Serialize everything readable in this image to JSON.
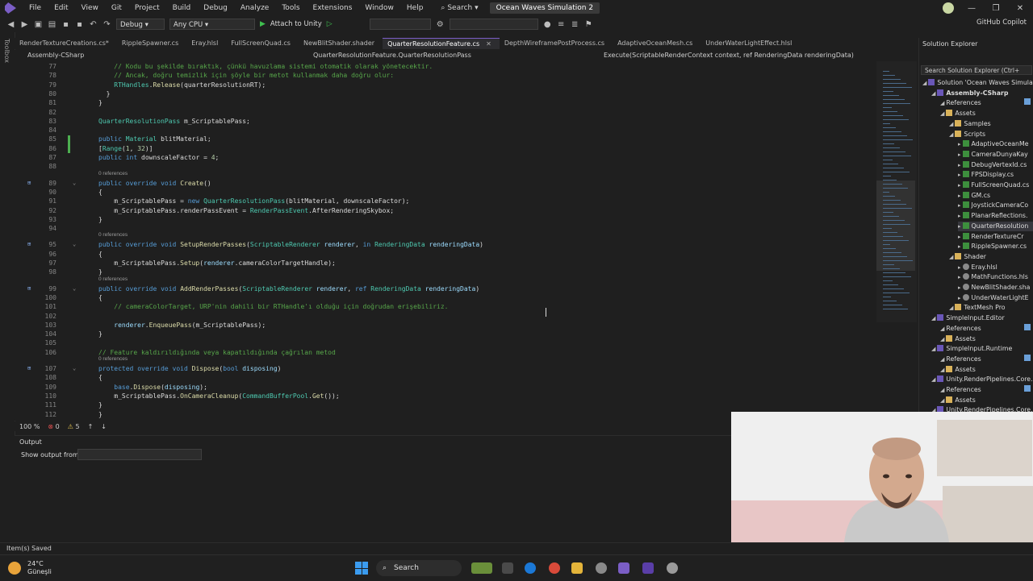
{
  "menubar": {
    "items": [
      "File",
      "Edit",
      "View",
      "Git",
      "Project",
      "Build",
      "Debug",
      "Analyze",
      "Tools",
      "Extensions",
      "Window",
      "Help"
    ],
    "search": "Search",
    "solution_name": "Ocean Waves Simulation 2",
    "copilot": "GitHub Copilot"
  },
  "toolbar": {
    "configuration": "Debug",
    "platform": "Any CPU",
    "attach": "Attach to Unity"
  },
  "left_strip": {
    "label": "Toolbox"
  },
  "tabs": [
    {
      "label": "RenderTextureCreations.cs*"
    },
    {
      "label": "RippleSpawner.cs"
    },
    {
      "label": "Eray.hlsl"
    },
    {
      "label": "FullScreenQuad.cs"
    },
    {
      "label": "NewBlitShader.shader"
    },
    {
      "label": "QuarterResolutionFeature.cs",
      "active": true
    },
    {
      "label": "DepthWireframePostProcess.cs"
    },
    {
      "label": "AdaptiveOceanMesh.cs"
    },
    {
      "label": "UnderWaterLightEffect.hlsl"
    }
  ],
  "navbar": {
    "project": "Assembly-CSharp",
    "type": "QuarterResolutionFeature.QuarterResolutionPass",
    "member": "Execute(ScriptableRenderContext context, ref RenderingData renderingData)"
  },
  "code": {
    "refs": "0 references",
    "lines": [
      {
        "n": "77",
        "t": "    // Kodu bu şekilde bıraktık, çünkü havuzlama sistemi otomatik olarak yönetecektir."
      },
      {
        "n": "78",
        "t": "    // Ancak, doğru temizlik için şöyle bir metot kullanmak daha doğru olur:"
      },
      {
        "n": "79",
        "t": "    RTHandles.Release(quarterResolutionRT);"
      },
      {
        "n": "80",
        "t": "  }"
      },
      {
        "n": "81",
        "t": "}"
      },
      {
        "n": "82",
        "t": ""
      },
      {
        "n": "83",
        "t": "QuarterResolutionPass m_ScriptablePass;"
      },
      {
        "n": "84",
        "t": ""
      },
      {
        "n": "85",
        "t": "public Material blitMaterial;"
      },
      {
        "n": "86",
        "t": "[Range(1, 32)]"
      },
      {
        "n": "87",
        "t": "public int downscaleFactor = 4;"
      },
      {
        "n": "88",
        "t": ""
      },
      {
        "n": "89",
        "t": "public override void Create()"
      },
      {
        "n": "90",
        "t": "{"
      },
      {
        "n": "91",
        "t": "    m_ScriptablePass = new QuarterResolutionPass(blitMaterial, downscaleFactor);"
      },
      {
        "n": "92",
        "t": "    m_ScriptablePass.renderPassEvent = RenderPassEvent.AfterRenderingSkybox;"
      },
      {
        "n": "93",
        "t": "}"
      },
      {
        "n": "94",
        "t": ""
      },
      {
        "n": "95",
        "t": "public override void SetupRenderPasses(ScriptableRenderer renderer, in RenderingData renderingData)"
      },
      {
        "n": "96",
        "t": "{"
      },
      {
        "n": "97",
        "t": "    m_ScriptablePass.Setup(renderer.cameraColorTargetHandle);"
      },
      {
        "n": "98",
        "t": "}"
      },
      {
        "n": "99",
        "t": "public override void AddRenderPasses(ScriptableRenderer renderer, ref RenderingData renderingData)"
      },
      {
        "n": "100",
        "t": "{"
      },
      {
        "n": "101",
        "t": "    // cameraColorTarget, URP'nin dahili bir RTHandle'ı olduğu için doğrudan erişebiliriz."
      },
      {
        "n": "102",
        "t": ""
      },
      {
        "n": "103",
        "t": "    renderer.EnqueuePass(m_ScriptablePass);"
      },
      {
        "n": "104",
        "t": "}"
      },
      {
        "n": "105",
        "t": ""
      },
      {
        "n": "106",
        "t": "// Feature kaldırıldığında veya kapatıldığında çağrılan metod"
      },
      {
        "n": "107",
        "t": "protected override void Dispose(bool disposing)"
      },
      {
        "n": "108",
        "t": "{"
      },
      {
        "n": "109",
        "t": "    base.Dispose(disposing);"
      },
      {
        "n": "110",
        "t": "    m_ScriptablePass.OnCameraCleanup(CommandBufferPool.Get());"
      },
      {
        "n": "111",
        "t": "}"
      },
      {
        "n": "112",
        "t": "}"
      }
    ]
  },
  "editor_status": {
    "zoom": "100 %",
    "errors": "0",
    "warnings": "5"
  },
  "output": {
    "title": "Output",
    "show_from": "Show output from:"
  },
  "solution_explorer": {
    "title": "Solution Explorer",
    "search": "Search Solution Explorer (Ctrl+",
    "nodes": [
      {
        "label": "Solution 'Ocean Waves Simulati",
        "indent": 0,
        "icon": "proj"
      },
      {
        "label": "Assembly-CSharp",
        "indent": 1,
        "icon": "proj",
        "bold": true
      },
      {
        "label": "References",
        "indent": 2,
        "icon": "ref"
      },
      {
        "label": "Assets",
        "indent": 2,
        "icon": "folder"
      },
      {
        "label": "Samples",
        "indent": 3,
        "icon": "folder"
      },
      {
        "label": "Scripts",
        "indent": 3,
        "icon": "folder"
      },
      {
        "label": "AdaptiveOceanMe",
        "indent": 4,
        "icon": "cs"
      },
      {
        "label": "CameraDunyaKay",
        "indent": 4,
        "icon": "cs"
      },
      {
        "label": "DebugVertexId.cs",
        "indent": 4,
        "icon": "cs"
      },
      {
        "label": "FPSDisplay.cs",
        "indent": 4,
        "icon": "cs"
      },
      {
        "label": "FullScreenQuad.cs",
        "indent": 4,
        "icon": "cs"
      },
      {
        "label": "GM.cs",
        "indent": 4,
        "icon": "cs"
      },
      {
        "label": "JoystickCameraCo",
        "indent": 4,
        "icon": "cs"
      },
      {
        "label": "PlanarReflections.",
        "indent": 4,
        "icon": "cs"
      },
      {
        "label": "QuarterResolution",
        "indent": 4,
        "icon": "cs",
        "selected": true
      },
      {
        "label": "RenderTextureCr",
        "indent": 4,
        "icon": "cs"
      },
      {
        "label": "RippleSpawner.cs",
        "indent": 4,
        "icon": "cs"
      },
      {
        "label": "Shader",
        "indent": 3,
        "icon": "folder"
      },
      {
        "label": "Eray.hlsl",
        "indent": 4,
        "icon": "hlsl"
      },
      {
        "label": "MathFunctions.hls",
        "indent": 4,
        "icon": "hlsl"
      },
      {
        "label": "NewBlitShader.sha",
        "indent": 4,
        "icon": "hlsl"
      },
      {
        "label": "UnderWaterLightE",
        "indent": 4,
        "icon": "hlsl"
      },
      {
        "label": "TextMesh Pro",
        "indent": 3,
        "icon": "folder"
      },
      {
        "label": "SimpleInput.Editor",
        "indent": 1,
        "icon": "proj"
      },
      {
        "label": "References",
        "indent": 2,
        "icon": "ref"
      },
      {
        "label": "Assets",
        "indent": 2,
        "icon": "folder"
      },
      {
        "label": "SimpleInput.Runtime",
        "indent": 1,
        "icon": "proj"
      },
      {
        "label": "References",
        "indent": 2,
        "icon": "ref"
      },
      {
        "label": "Assets",
        "indent": 2,
        "icon": "folder"
      },
      {
        "label": "Unity.RenderPipelines.Core.S",
        "indent": 1,
        "icon": "proj"
      },
      {
        "label": "References",
        "indent": 2,
        "icon": "ref"
      },
      {
        "label": "Assets",
        "indent": 2,
        "icon": "folder"
      },
      {
        "label": "Unity.RenderPipelines.Core.S",
        "indent": 1,
        "icon": "proj"
      }
    ]
  },
  "statusbar": {
    "message": "Item(s) Saved"
  },
  "taskbar": {
    "temperature": "24°C",
    "weather": "Güneşli",
    "search": "Search"
  },
  "colors": {
    "accent": "#7b5ec6",
    "keyword": "#569cd6",
    "type": "#4ec9b0",
    "comment": "#57a64a",
    "method": "#dcdcaa"
  }
}
